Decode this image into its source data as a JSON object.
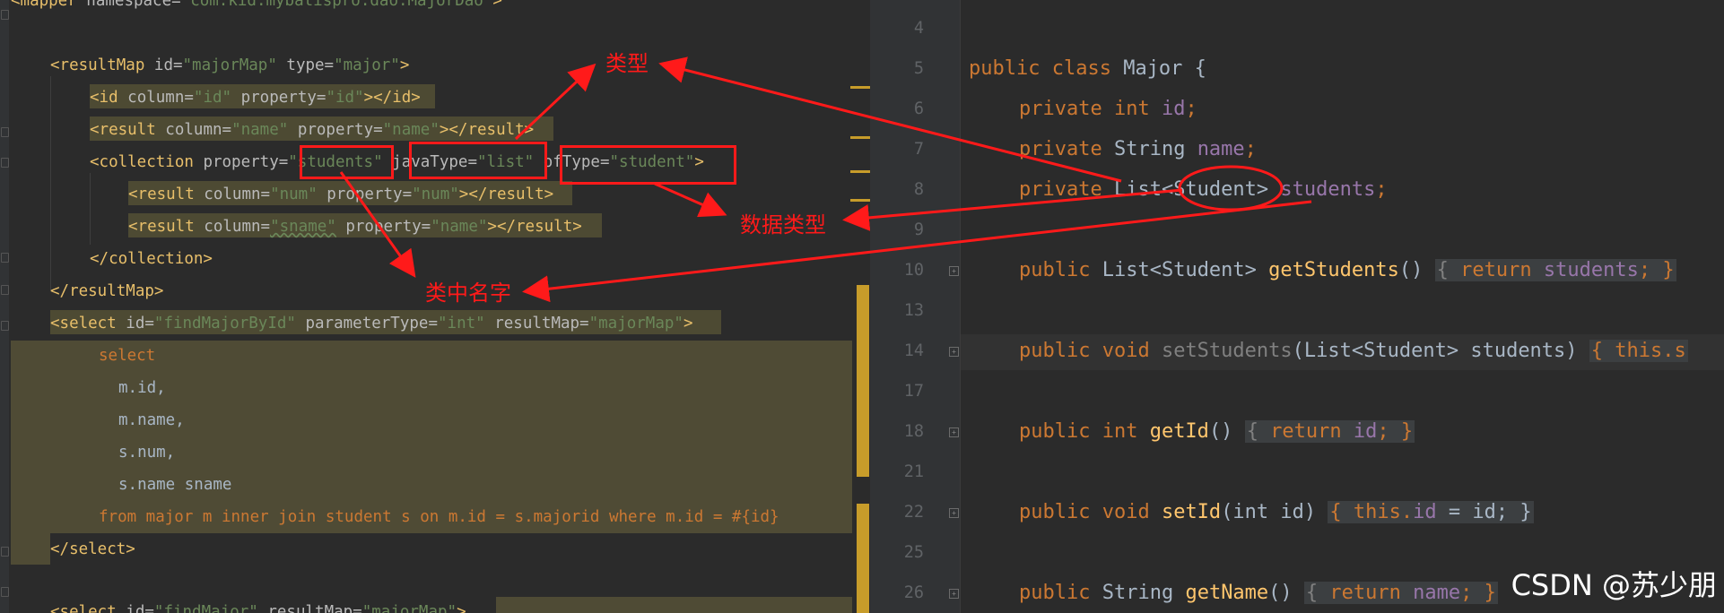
{
  "left": {
    "lines": [
      {
        "open": "<mapper ",
        "attr1": "namespace=",
        "val1": "\"com.kid.mybatispro.dao.MajorDao\"",
        "close": ">"
      },
      {
        "open": "<resultMap ",
        "attr1": "id=",
        "val1": "\"majorMap\"",
        "attr2": " type=",
        "val2": "\"major\"",
        "close": ">"
      },
      {
        "open": "<id ",
        "attr1": "column=",
        "val1": "\"id\"",
        "attr2": " property=",
        "val2": "\"id\"",
        "close": "></id>"
      },
      {
        "open": "<result ",
        "attr1": "column=",
        "val1": "\"name\"",
        "attr2": " property=",
        "val2": "\"name\"",
        "close": "></result>"
      },
      {
        "open": "<collection ",
        "attr1": "property=",
        "val1": "\"students\"",
        "attr2": " javaType=",
        "val2": "\"list\"",
        "attr3": " ofType=",
        "val3": "\"student\"",
        "close": ">"
      },
      {
        "open": "<result ",
        "attr1": "column=",
        "val1": "\"num\"",
        "attr2": " property=",
        "val2": "\"num\"",
        "close": "></result>"
      },
      {
        "open": "<result ",
        "attr1": "column=",
        "val1": "\"sname\"",
        "attr2": " property=",
        "val2": "\"name\"",
        "close": "></result>"
      },
      {
        "open": "</collection>"
      },
      {
        "open": "</resultMap>"
      },
      {
        "open": "<select ",
        "attr1": "id=",
        "val1": "\"findMajorById\"",
        "attr2": " parameterType=",
        "val2": "\"int\"",
        "attr3": " resultMap=",
        "val3": "\"majorMap\"",
        "close": ">"
      },
      {
        "sql": "select"
      },
      {
        "sql": "m.id,"
      },
      {
        "sql": "m.name,"
      },
      {
        "sql": "s.num,"
      },
      {
        "sql": "s.name sname"
      },
      {
        "sql": "from major m inner join student s on m.id = s.majorid where m.id = #{id}"
      },
      {
        "open": "</select>"
      },
      {
        "open": "<select ",
        "attr1": "id=",
        "val1": "\"findMajor\"",
        "attr2": " resultMap=",
        "val2": "\"majorMap\"",
        "close": ">"
      }
    ]
  },
  "right": {
    "line_numbers": [
      "4",
      "5",
      "6",
      "7",
      "8",
      "9",
      "10",
      "13",
      "14",
      "17",
      "18",
      "21",
      "22",
      "25",
      "26"
    ],
    "code": {
      "l5": {
        "kw": "public class",
        "name": " Major {"
      },
      "l6": {
        "kw": "private int",
        "field": "id",
        "semi": ";"
      },
      "l7": {
        "kw": "private",
        "type": " String ",
        "field": "name",
        "semi": ";"
      },
      "l8": {
        "kw": "private",
        "type": " List<Student> ",
        "field": "students",
        "semi": ";"
      },
      "l10": {
        "kw": "public",
        "type": " List<Student> ",
        "method": "getStudents",
        "paren": "() ",
        "body_kw": "return",
        "field": "students",
        "end": "; }"
      },
      "l14": {
        "kw": "public void",
        "method": " setStudents",
        "params": "(List<Student> students) ",
        "body": "{ this.s"
      },
      "l18": {
        "kw": "public int",
        "method": " getId",
        "paren": "() ",
        "body_kw": "return",
        "field": "id",
        "end": "; }"
      },
      "l22": {
        "kw": "public void",
        "method": " setId",
        "params": "(int id) ",
        "body": "{ this.",
        "field": "id",
        "assign": " = id; }"
      },
      "l26": {
        "kw": "public",
        "type": " String ",
        "method": "getName",
        "paren": "() ",
        "body_kw": "return",
        "field": "name",
        "end": "; }"
      }
    }
  },
  "annotations": {
    "type_label": "类型",
    "datatype_label": "数据类型",
    "name_label": "类中名字"
  },
  "watermark": "CSDN @苏少朋",
  "colors": {
    "annotation": "#ff1a1a",
    "tag": "#e8bf6a",
    "string": "#6a8759",
    "keyword": "#cc7832",
    "field": "#9876aa",
    "method": "#ffc66d",
    "background": "#2b2b2b"
  }
}
